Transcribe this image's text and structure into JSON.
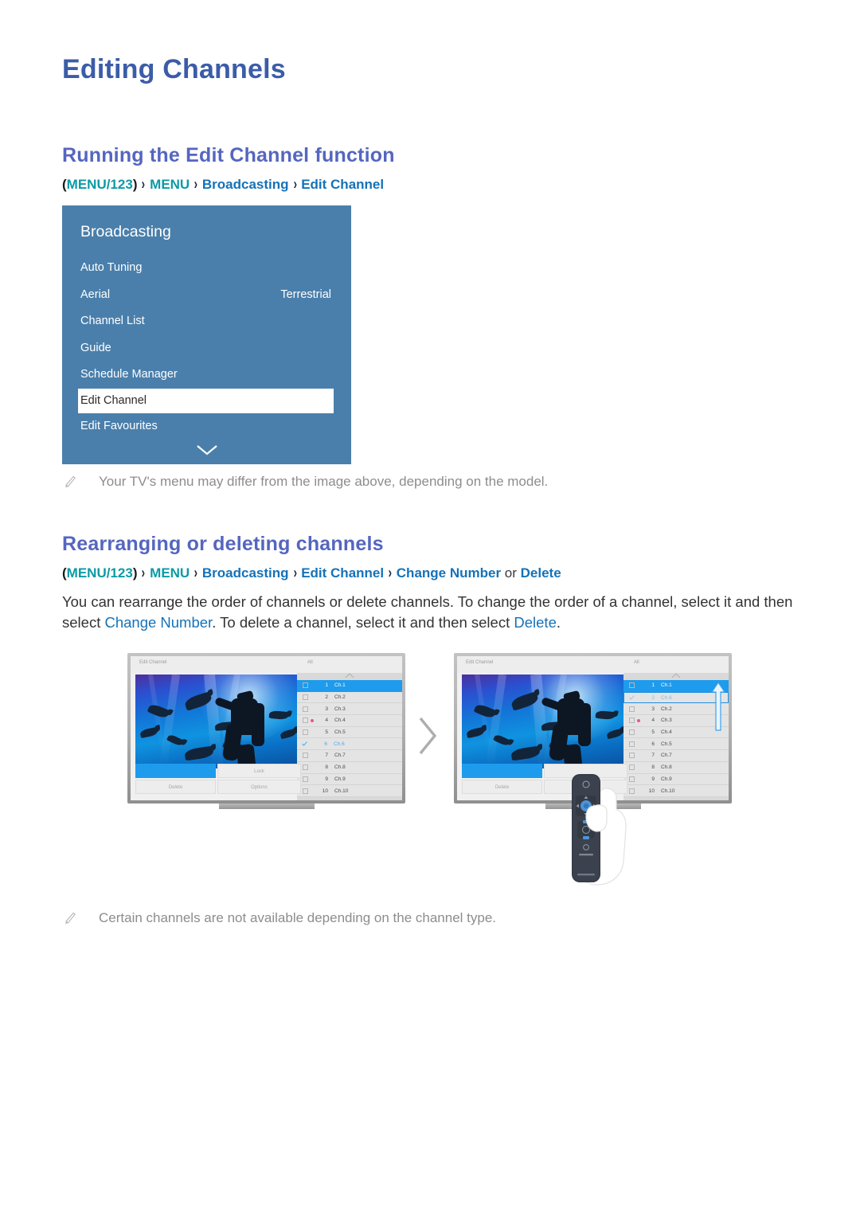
{
  "page": {
    "title": "Editing Channels"
  },
  "sections": [
    {
      "heading": "Running the Edit Channel function",
      "breadcrumb": {
        "open_paren": "(",
        "menu123": "MENU/123",
        "close_paren": ")",
        "sep": "›",
        "menu": "MENU",
        "broadcasting": "Broadcasting",
        "edit_channel": "Edit Channel"
      },
      "note": {
        "icon": "pencil-icon",
        "text": "Your TV's menu may differ from the image above, depending on the model."
      }
    },
    {
      "heading": "Rearranging or deleting channels",
      "breadcrumb": {
        "open_paren": "(",
        "menu123": "MENU/123",
        "close_paren": ")",
        "sep": "›",
        "menu": "MENU",
        "broadcasting": "Broadcasting",
        "edit_channel": "Edit Channel",
        "change_number": "Change Number",
        "or": " or ",
        "delete": "Delete"
      },
      "paragraph": {
        "part1": "You can rearrange the order of channels or delete channels. To change the order of a channel, select it and then select ",
        "link1": "Change Number",
        "part2": ". To delete a channel, select it and then select ",
        "link2": "Delete",
        "part3": "."
      },
      "note": {
        "icon": "pencil-icon",
        "text": "Certain channels are not available depending on the channel type."
      }
    }
  ],
  "tv_menu": {
    "title": "Broadcasting",
    "rows": [
      {
        "label": "Auto Tuning",
        "value": "",
        "selected": false
      },
      {
        "label": "Aerial",
        "value": "Terrestrial",
        "selected": false
      },
      {
        "label": "Channel List",
        "value": "",
        "selected": false
      },
      {
        "label": "Guide",
        "value": "",
        "selected": false
      },
      {
        "label": "Schedule Manager",
        "value": "",
        "selected": false
      },
      {
        "label": "Edit Channel",
        "value": "",
        "selected": true
      },
      {
        "label": "Edit Favourites",
        "value": "",
        "selected": false
      }
    ],
    "more_icon": "chevron-down-icon",
    "colors": {
      "panel_bg": "#4a7fab",
      "selected_bg": "#ffffff",
      "text": "#ffffff"
    }
  },
  "figure": {
    "transition_icon": "chevron-right-icon",
    "remote_icon": "tv-remote-in-hand-icon",
    "tv_before": {
      "screen_title": "Edit Channel",
      "filter_label": "All",
      "buttons": [
        {
          "label": "",
          "primary": true
        },
        {
          "label": "Lock",
          "primary": false
        },
        {
          "label": "Delete",
          "primary": false
        },
        {
          "label": "Options",
          "primary": false
        }
      ],
      "channels": [
        {
          "num": "1",
          "name": "Ch.1",
          "state": "highlight"
        },
        {
          "num": "2",
          "name": "Ch.2",
          "state": "normal"
        },
        {
          "num": "3",
          "name": "Ch.3",
          "state": "normal"
        },
        {
          "num": "4",
          "name": "Ch.4",
          "state": "marked"
        },
        {
          "num": "5",
          "name": "Ch.5",
          "state": "normal"
        },
        {
          "num": "6",
          "name": "Ch.6",
          "state": "checked"
        },
        {
          "num": "7",
          "name": "Ch.7",
          "state": "normal"
        },
        {
          "num": "8",
          "name": "Ch.8",
          "state": "normal"
        },
        {
          "num": "9",
          "name": "Ch.9",
          "state": "normal"
        },
        {
          "num": "10",
          "name": "Ch.10",
          "state": "normal"
        }
      ]
    },
    "tv_after": {
      "screen_title": "Edit Channel",
      "filter_label": "All",
      "move_arrow_icon": "arrow-up-icon",
      "buttons": [
        {
          "label": "",
          "primary": true
        },
        {
          "label": "",
          "primary": false
        },
        {
          "label": "Delete",
          "primary": false
        },
        {
          "label": "",
          "primary": false
        }
      ],
      "channels": [
        {
          "num": "1",
          "name": "Ch.1",
          "state": "highlight"
        },
        {
          "num": "2",
          "name": "Ch.6",
          "state": "moved"
        },
        {
          "num": "3",
          "name": "Ch.2",
          "state": "normal"
        },
        {
          "num": "4",
          "name": "Ch.3",
          "state": "marked"
        },
        {
          "num": "5",
          "name": "Ch.4",
          "state": "normal"
        },
        {
          "num": "6",
          "name": "Ch.5",
          "state": "normal"
        },
        {
          "num": "7",
          "name": "Ch.7",
          "state": "normal"
        },
        {
          "num": "8",
          "name": "Ch.8",
          "state": "normal"
        },
        {
          "num": "9",
          "name": "Ch.9",
          "state": "normal"
        },
        {
          "num": "10",
          "name": "Ch.10",
          "state": "normal"
        }
      ]
    }
  },
  "colors": {
    "title": "#3b5ca8",
    "section_heading": "#5566bf",
    "teal_link": "#0b9aa6",
    "blue_link": "#1572b8",
    "body_text": "#333333",
    "note_text": "#8d8d8d",
    "tv_panel": "#4a7fab",
    "tv_highlight": "#1e9bec",
    "marker_pink": "#f0528c"
  }
}
